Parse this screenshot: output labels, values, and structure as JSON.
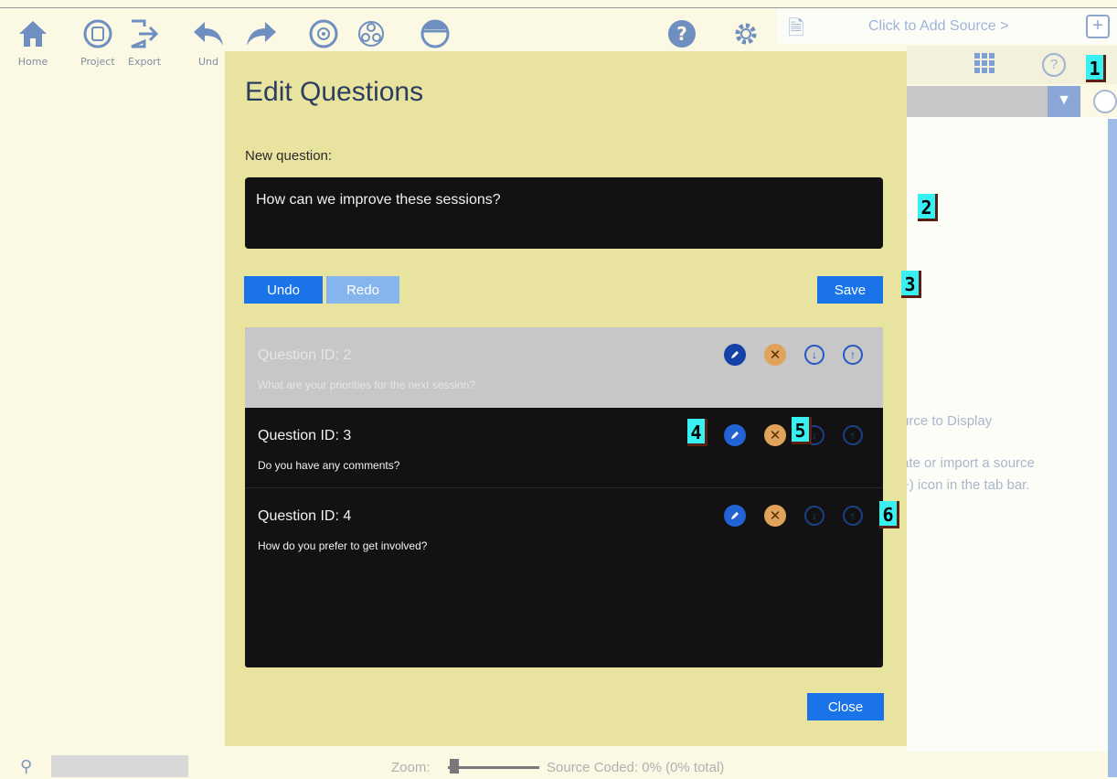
{
  "toolbar": {
    "items": [
      {
        "label": "Home",
        "icon": "home-icon"
      },
      {
        "label": "Project",
        "icon": "project-icon"
      },
      {
        "label": "Export",
        "icon": "export-icon"
      },
      {
        "label": "Und",
        "icon": "undo-icon"
      },
      {
        "label": "",
        "icon": "redo-icon"
      },
      {
        "label": "",
        "icon": "view-icon"
      },
      {
        "label": "",
        "icon": "network-icon"
      },
      {
        "label": "",
        "icon": "bowl-icon"
      },
      {
        "label": "",
        "icon": "help-icon"
      },
      {
        "label": "",
        "icon": "settings-icon"
      }
    ]
  },
  "source_bar": {
    "add_source_text": "Click to Add Source >",
    "add_tab_symbol": "+"
  },
  "empty_state": {
    "title_fragment": "urce to Display",
    "line1_fragment": "ate or import a source",
    "line2_fragment": "+) icon in the tab bar."
  },
  "statusbar": {
    "zoom_label": "Zoom:",
    "coded_label": "Source Coded: 0% (0% total)"
  },
  "modal": {
    "title": "Edit Questions",
    "new_question_label": "New question:",
    "new_question_value": "How can we improve these sessions?",
    "undo_label": "Undo",
    "redo_label": "Redo",
    "save_label": "Save",
    "close_label": "Close",
    "questions": [
      {
        "id_label": "Question ID: 2",
        "text": "What are your priorities for the next session?",
        "selected": true
      },
      {
        "id_label": "Question ID: 3",
        "text": "Do you have any comments?",
        "selected": false
      },
      {
        "id_label": "Question ID: 4",
        "text": "How do you prefer to get involved?",
        "selected": false
      }
    ]
  },
  "markers": [
    "1",
    "2",
    "3",
    "4",
    "5",
    "6"
  ],
  "colors": {
    "app_background": "#fbf8e4",
    "modal_background": "#e8e39e",
    "primary_button": "#1a73e8",
    "disabled_button": "#86b4ec",
    "list_background": "#121212",
    "selected_row": "#c7c7c7",
    "delete_icon": "#e0a35d",
    "marker": "#38f0f2"
  }
}
